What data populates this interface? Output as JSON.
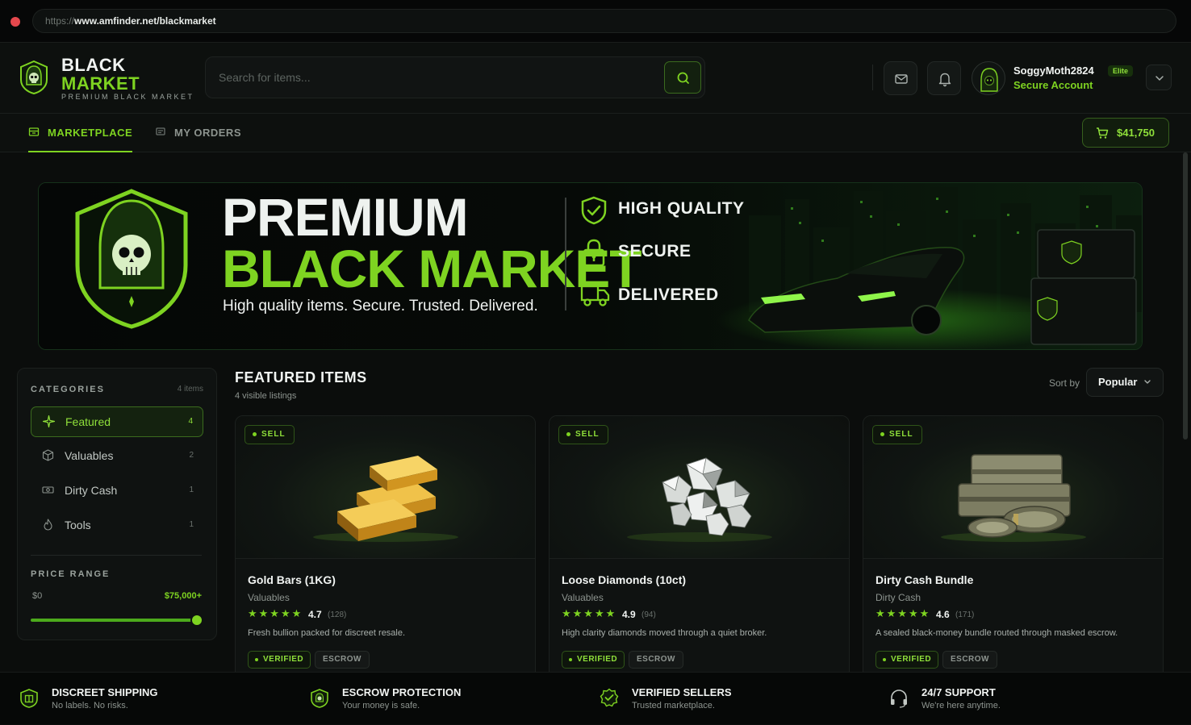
{
  "browser": {
    "url_scheme": "https://",
    "url_host": "www.amfinder.net/blackmarket"
  },
  "header": {
    "brand_line1": "BLACK",
    "brand_line2": "MARKET",
    "brand_sub": "PREMIUM BLACK MARKET",
    "search_placeholder": "Search for items...",
    "username": "SoggyMoth2824",
    "user_badge": "Elite",
    "account_status": "Secure Account"
  },
  "nav": {
    "tabs": [
      {
        "label": "MARKETPLACE",
        "active": true,
        "icon": "store-icon"
      },
      {
        "label": "MY ORDERS",
        "active": false,
        "icon": "receipt-icon"
      }
    ],
    "cart_total": "$41,750"
  },
  "banner": {
    "title_line1": "PREMIUM",
    "title_line2": "BLACK MARKET",
    "tagline": "High quality items. Secure. Trusted. Delivered.",
    "features": [
      {
        "label": "HIGH QUALITY",
        "icon": "shield-check-icon"
      },
      {
        "label": "SECURE",
        "icon": "lock-icon"
      },
      {
        "label": "DELIVERED",
        "icon": "truck-icon"
      }
    ]
  },
  "sidebar": {
    "categories_heading": "CATEGORIES",
    "categories_count": "4 items",
    "categories": [
      {
        "label": "Featured",
        "count": "4",
        "active": true,
        "icon": "sparkle-icon"
      },
      {
        "label": "Valuables",
        "count": "2",
        "active": false,
        "icon": "box-icon"
      },
      {
        "label": "Dirty Cash",
        "count": "1",
        "active": false,
        "icon": "banknote-icon"
      },
      {
        "label": "Tools",
        "count": "1",
        "active": false,
        "icon": "flame-icon"
      }
    ],
    "price_heading": "PRICE RANGE",
    "price_min": "$0",
    "price_max": "$75,000+",
    "price_slider_fraction": 1.0
  },
  "featured": {
    "title": "FEATURED ITEMS",
    "subtitle": "4 visible listings",
    "sort_label": "Sort by",
    "sort_value": "Popular",
    "items": [
      {
        "type_badge": "SELL",
        "name": "Gold Bars (1KG)",
        "category": "Valuables",
        "stars": "★★★★★",
        "rating": "4.7",
        "reviews": "(128)",
        "description": "Fresh bullion packed for discreet resale.",
        "badge_verified": "VERIFIED",
        "badge_escrow": "ESCROW",
        "image": "gold-bars-icon"
      },
      {
        "type_badge": "SELL",
        "name": "Loose Diamonds (10ct)",
        "category": "Valuables",
        "stars": "★★★★★",
        "rating": "4.9",
        "reviews": "(94)",
        "description": "High clarity diamonds moved through a quiet broker.",
        "badge_verified": "VERIFIED",
        "badge_escrow": "ESCROW",
        "image": "diamonds-icon"
      },
      {
        "type_badge": "SELL",
        "name": "Dirty Cash Bundle",
        "category": "Dirty Cash",
        "stars": "★★★★★",
        "rating": "4.6",
        "reviews": "(171)",
        "description": "A sealed black-money bundle routed through masked escrow.",
        "badge_verified": "VERIFIED",
        "badge_escrow": "ESCROW",
        "image": "cash-stack-icon"
      }
    ]
  },
  "footer": {
    "items": [
      {
        "title": "DISCREET SHIPPING",
        "subtitle": "No labels. No risks.",
        "icon": "package-shield-icon"
      },
      {
        "title": "ESCROW PROTECTION",
        "subtitle": "Your money is safe.",
        "icon": "shield-icon"
      },
      {
        "title": "VERIFIED SELLERS",
        "subtitle": "Trusted marketplace.",
        "icon": "verified-badge-icon"
      },
      {
        "title": "24/7 SUPPORT",
        "subtitle": "We're here anytime.",
        "icon": "headset-icon"
      }
    ]
  },
  "colors": {
    "accent": "#7ed321",
    "background": "#0b0d0c",
    "panel": "#0f1211"
  }
}
